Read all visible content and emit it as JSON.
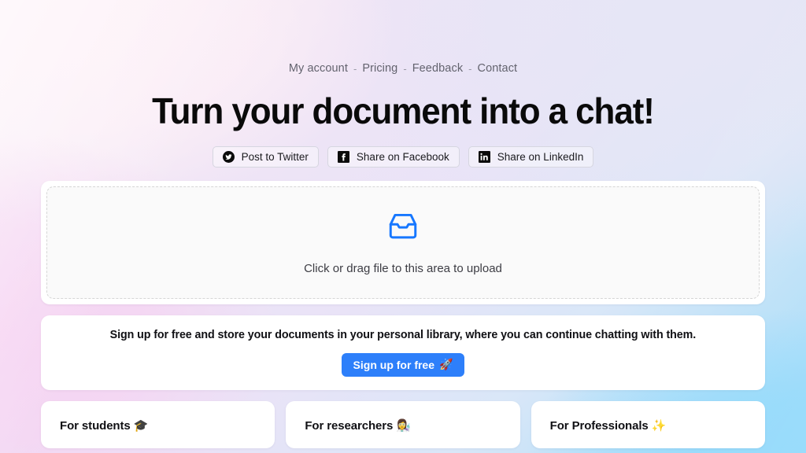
{
  "theme": {
    "accent_blue": "#2d7ffa",
    "icon_blue": "#1677ff",
    "heading_color": "#0a0a0a",
    "bg_pink": "#f6d3f2",
    "bg_sky": "#8ed8fb",
    "bg_lavender": "#e6e6f6"
  },
  "nav": {
    "separator": "-",
    "items": [
      {
        "label": "My account",
        "name": "nav-my-account"
      },
      {
        "label": "Pricing",
        "name": "nav-pricing"
      },
      {
        "label": "Feedback",
        "name": "nav-feedback"
      },
      {
        "label": "Contact",
        "name": "nav-contact"
      }
    ]
  },
  "hero": {
    "headline": "Turn your document into a chat!"
  },
  "share": {
    "buttons": [
      {
        "label": "Post to Twitter",
        "icon": "twitter-icon"
      },
      {
        "label": "Share on Facebook",
        "icon": "facebook-icon"
      },
      {
        "label": "Share on LinkedIn",
        "icon": "linkedin-icon"
      }
    ]
  },
  "upload": {
    "icon": "inbox-tray-icon",
    "text": "Click or drag file to this area to upload"
  },
  "signup": {
    "text": "Sign up for free and store your documents in your personal library, where you can continue chatting with them.",
    "button_label": "Sign up for free",
    "button_emoji": "🚀"
  },
  "audience_cards": [
    {
      "title": "For students",
      "emoji": "🎓"
    },
    {
      "title": "For researchers",
      "emoji": "👩‍🔬"
    },
    {
      "title": "For Professionals",
      "emoji": "✨"
    }
  ]
}
